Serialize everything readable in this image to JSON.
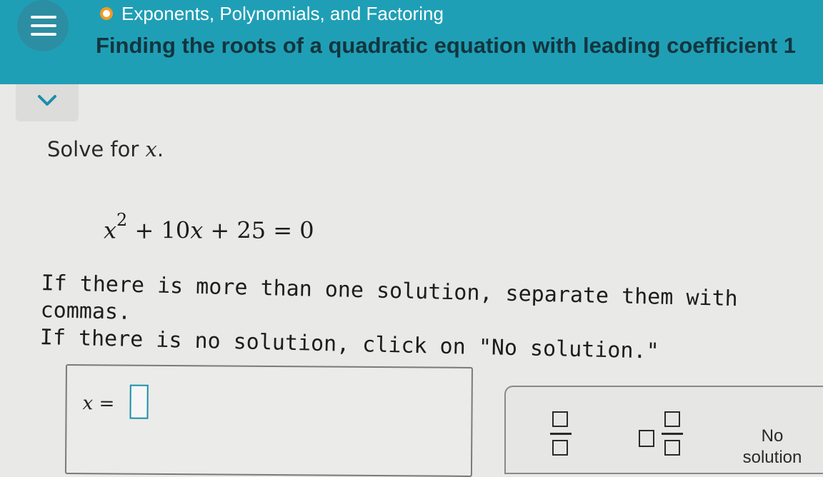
{
  "header": {
    "topic": "Exponents, Polynomials, and Factoring",
    "title": "Finding the roots of a quadratic equation with leading coefficient 1"
  },
  "problem": {
    "prompt_text": "Solve for ",
    "prompt_var": "x",
    "prompt_end": ".",
    "equation": {
      "term1_var": "x",
      "term1_exp": "2",
      "op1": "+",
      "term2": "10",
      "term2_var": "x",
      "op2": "+",
      "term3": "25",
      "eq": "=",
      "rhs": "0"
    },
    "instruction_line1": "If there is more than one solution, separate them with commas.",
    "instruction_line2": "If there is no solution, click on \"No solution.\""
  },
  "answer": {
    "var": "x",
    "eq": " = ",
    "value": ""
  },
  "keypad": {
    "no_solution_label": "No solution"
  },
  "colors": {
    "header_bg": "#1f9fb5",
    "topic_dot": "#f29a21",
    "input_border": "#1a8fa8"
  }
}
